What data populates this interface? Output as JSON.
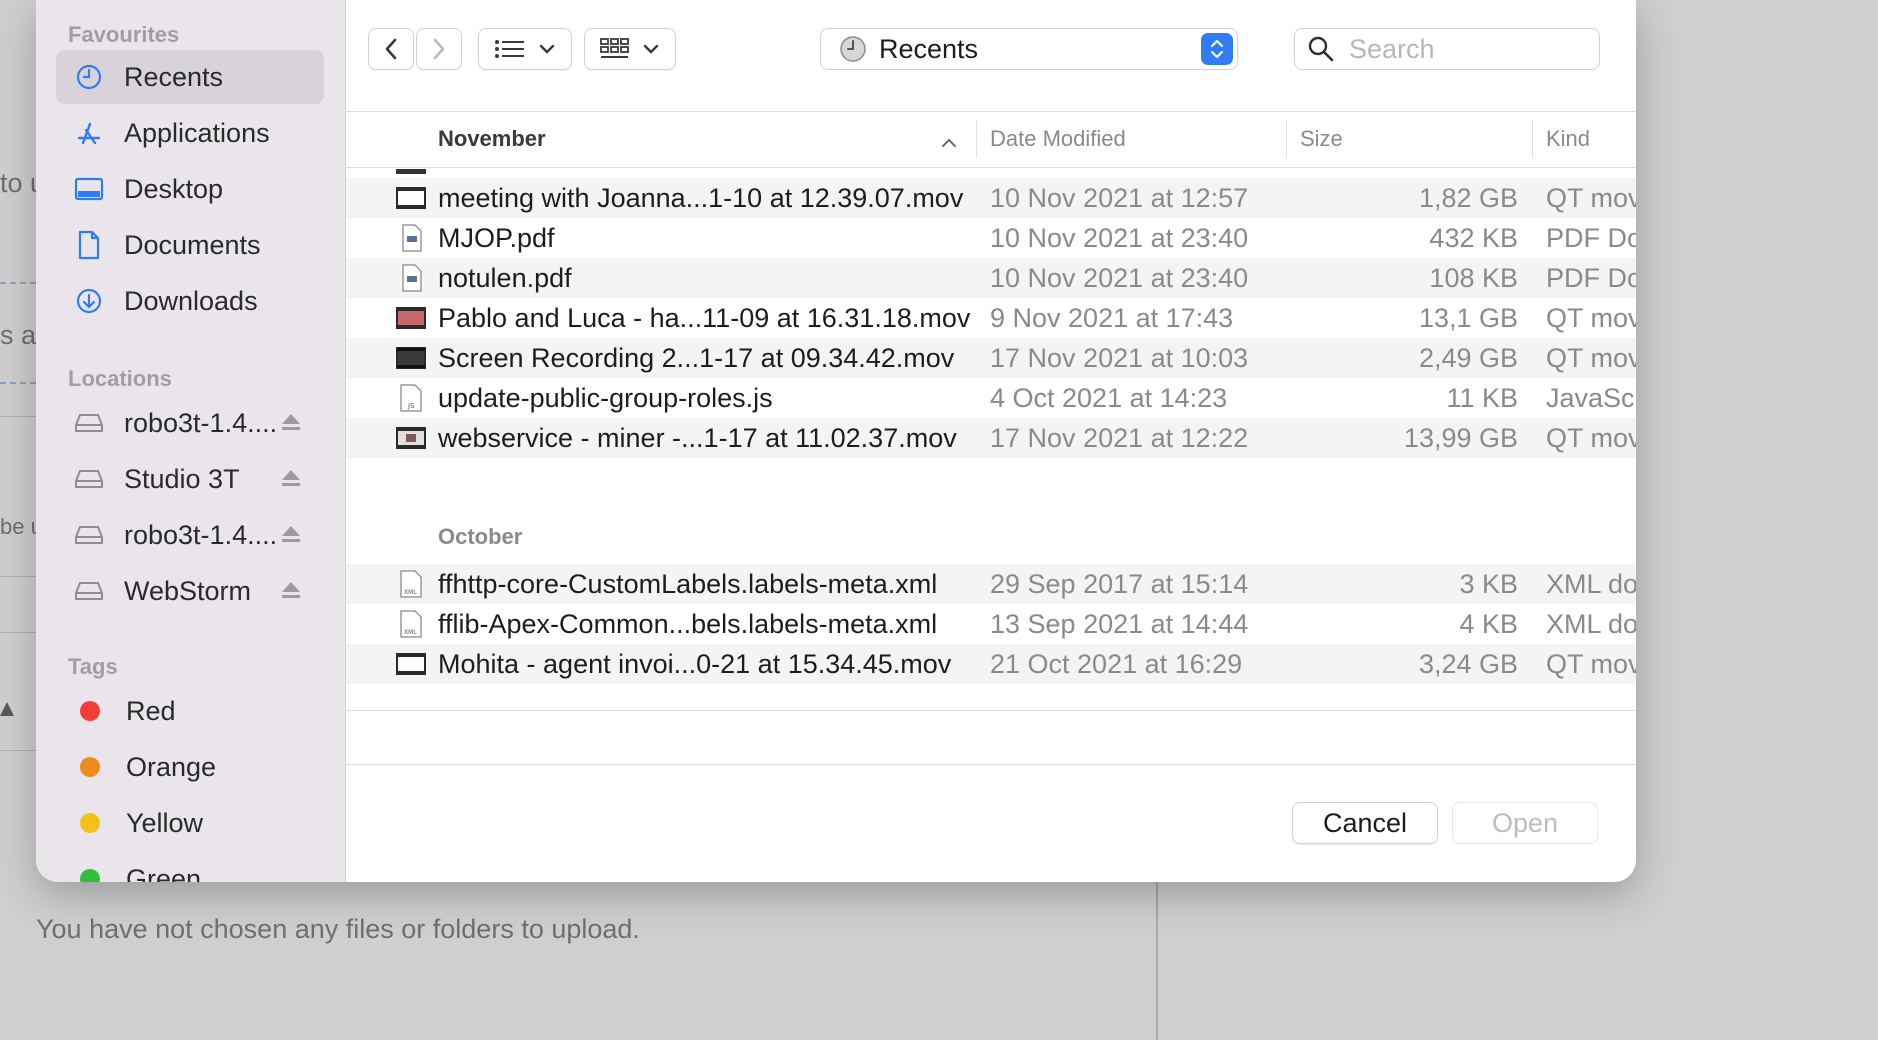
{
  "background": {
    "fragments": [
      "to u",
      "s ar",
      "be u"
    ],
    "upload_text": "You have not chosen any files or folders to upload."
  },
  "sidebar": {
    "favourites_title": "Favourites",
    "favourites": [
      {
        "label": "Recents",
        "icon": "clock-icon",
        "active": true
      },
      {
        "label": "Applications",
        "icon": "applications-icon"
      },
      {
        "label": "Desktop",
        "icon": "desktop-icon"
      },
      {
        "label": "Documents",
        "icon": "document-icon"
      },
      {
        "label": "Downloads",
        "icon": "download-icon"
      }
    ],
    "locations_title": "Locations",
    "locations": [
      {
        "label": "robo3t-1.4....",
        "icon": "drive-icon"
      },
      {
        "label": "Studio 3T",
        "icon": "drive-icon"
      },
      {
        "label": "robo3t-1.4....",
        "icon": "drive-icon"
      },
      {
        "label": "WebStorm",
        "icon": "drive-icon"
      }
    ],
    "tags_title": "Tags",
    "tags": [
      {
        "label": "Red",
        "color": "#f23d3a"
      },
      {
        "label": "Orange",
        "color": "#f08a1c"
      },
      {
        "label": "Yellow",
        "color": "#f2c21a"
      },
      {
        "label": "Green",
        "color": "#2fbf3a"
      }
    ]
  },
  "toolbar": {
    "location": "Recents",
    "search_placeholder": "Search"
  },
  "columns": {
    "name": "November",
    "date": "Date Modified",
    "size": "Size",
    "kind": "Kind"
  },
  "groups": {
    "november": "November",
    "october": "October"
  },
  "files_november": [
    {
      "name": "meeting with Joanna...1-10 at 12.39.07.mov",
      "date": "10 Nov 2021 at 12:57",
      "size": "1,82 GB",
      "kind": "QT mov",
      "icon": "video-file-icon"
    },
    {
      "name": "MJOP.pdf",
      "date": "10 Nov 2021 at 23:40",
      "size": "432 KB",
      "kind": "PDF Do",
      "icon": "pdf-file-icon"
    },
    {
      "name": "notulen.pdf",
      "date": "10 Nov 2021 at 23:40",
      "size": "108 KB",
      "kind": "PDF Do",
      "icon": "pdf-file-icon"
    },
    {
      "name": "Pablo and Luca - ha...11-09 at 16.31.18.mov",
      "date": "9 Nov 2021 at 17:43",
      "size": "13,1 GB",
      "kind": "QT mov",
      "icon": "video-file-icon"
    },
    {
      "name": "Screen Recording 2...1-17 at 09.34.42.mov",
      "date": "17 Nov 2021 at 10:03",
      "size": "2,49 GB",
      "kind": "QT mov",
      "icon": "video-file-icon"
    },
    {
      "name": "update-public-group-roles.js",
      "date": "4 Oct 2021 at 14:23",
      "size": "11 KB",
      "kind": "JavaSc.",
      "icon": "js-file-icon"
    },
    {
      "name": "webservice - miner -...1-17 at 11.02.37.mov",
      "date": "17 Nov 2021 at 12:22",
      "size": "13,99 GB",
      "kind": "QT mov",
      "icon": "video-file-icon"
    }
  ],
  "files_october": [
    {
      "name": "ffhttp-core-CustomLabels.labels-meta.xml",
      "date": "29 Sep 2017 at 15:14",
      "size": "3 KB",
      "kind": "XML do",
      "icon": "xml-file-icon"
    },
    {
      "name": "fflib-Apex-Common...bels.labels-meta.xml",
      "date": "13 Sep 2021 at 14:44",
      "size": "4 KB",
      "kind": "XML do",
      "icon": "xml-file-icon"
    },
    {
      "name": "Mohita - agent invoi...0-21 at 15.34.45.mov",
      "date": "21 Oct 2021 at 16:29",
      "size": "3,24 GB",
      "kind": "QT mov",
      "icon": "video-file-icon"
    }
  ],
  "footer": {
    "cancel": "Cancel",
    "open": "Open"
  }
}
